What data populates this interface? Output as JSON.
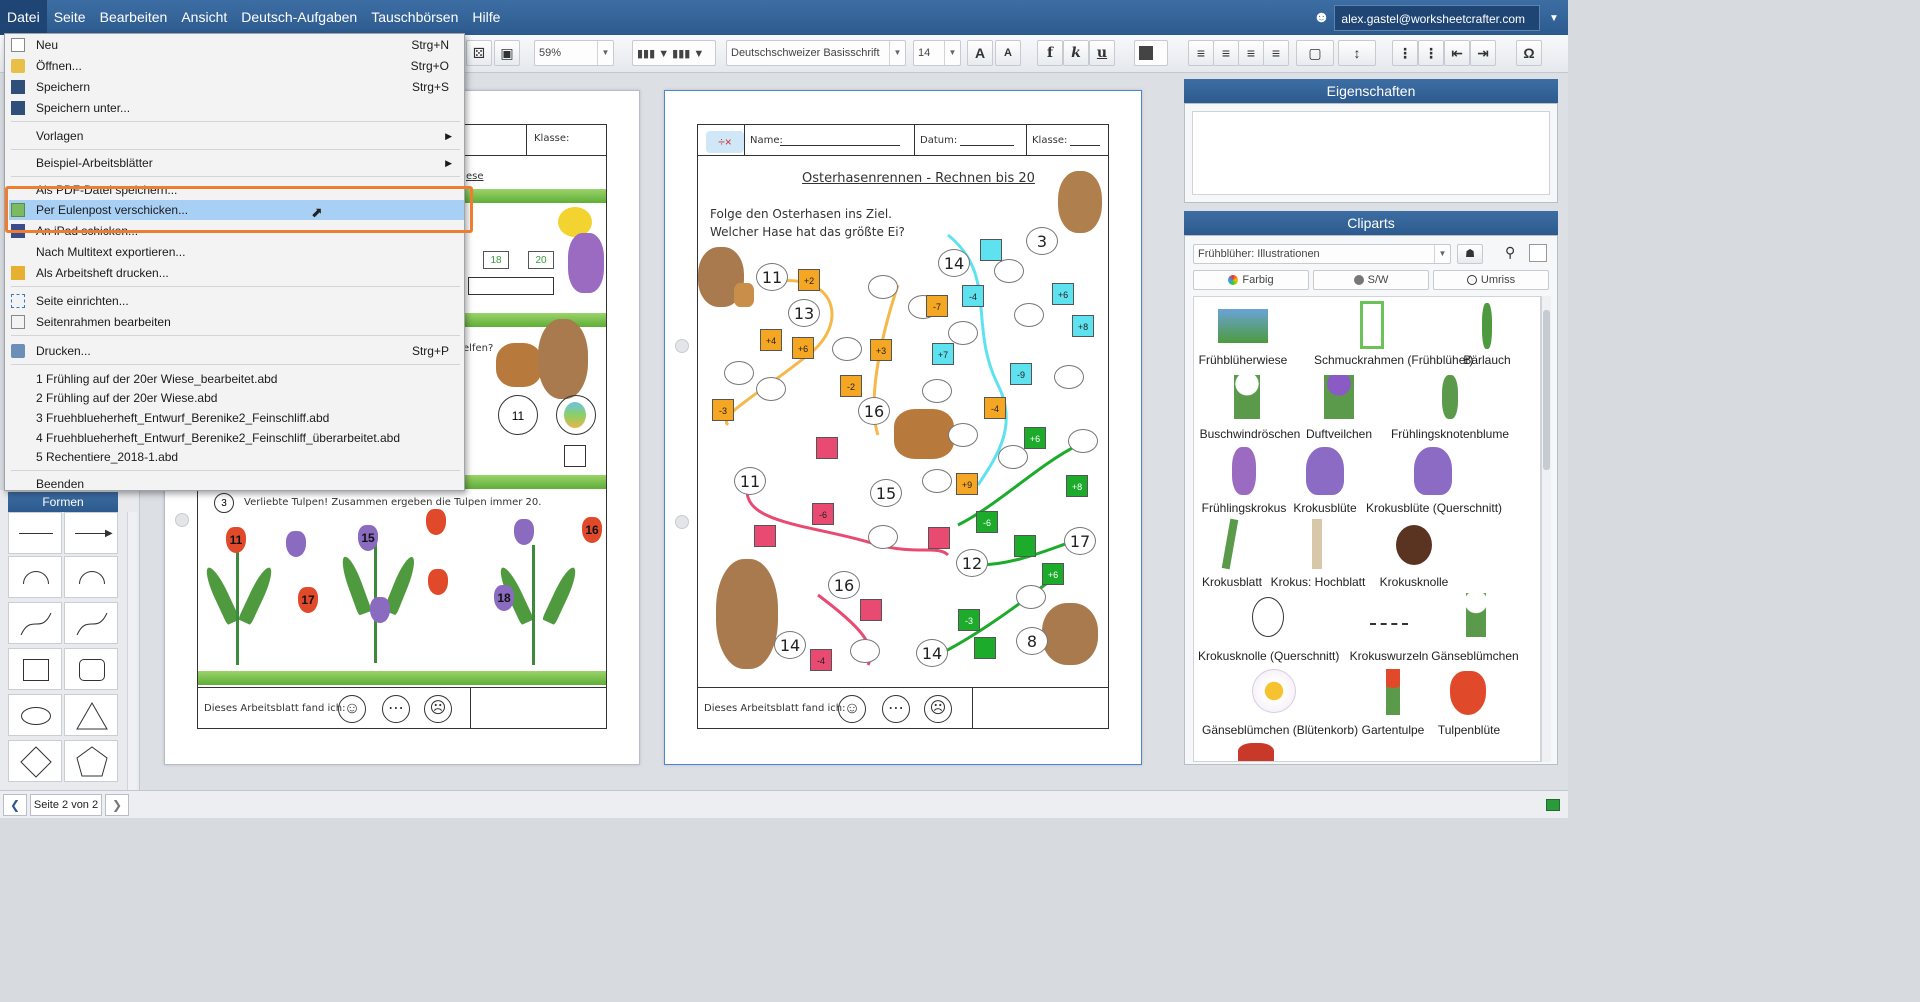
{
  "menubar": {
    "items": [
      "Datei",
      "Seite",
      "Bearbeiten",
      "Ansicht",
      "Deutsch-Aufgaben",
      "Tauschbörsen",
      "Hilfe"
    ],
    "user_email": "alex.gastel@worksheetcrafter.com"
  },
  "toolbar": {
    "zoom": "59%",
    "font": "Deutschschweizer Basisschrift",
    "font_size": "14",
    "bold": "f",
    "italic": "k",
    "underline": "u"
  },
  "file_menu": {
    "items": [
      {
        "label": "Neu",
        "shortcut": "Strg+N"
      },
      {
        "label": "Öffnen...",
        "shortcut": "Strg+O"
      },
      {
        "label": "Speichern",
        "shortcut": "Strg+S"
      },
      {
        "label": "Speichern unter...",
        "shortcut": ""
      },
      {
        "label": "Vorlagen",
        "shortcut": ""
      },
      {
        "label": "Beispiel-Arbeitsblätter",
        "shortcut": ""
      },
      {
        "label": "Als PDF-Datei speichern...",
        "shortcut": ""
      },
      {
        "label": "Per Eulenpost verschicken...",
        "shortcut": ""
      },
      {
        "label": "An iPad schicken...",
        "shortcut": ""
      },
      {
        "label": "Nach Multitext exportieren...",
        "shortcut": ""
      },
      {
        "label": "Als Arbeitsheft drucken...",
        "shortcut": ""
      },
      {
        "label": "Seite einrichten...",
        "shortcut": ""
      },
      {
        "label": "Seitenrahmen bearbeiten",
        "shortcut": ""
      },
      {
        "label": "Drucken...",
        "shortcut": "Strg+P"
      },
      {
        "label": "1 Frühling auf der 20er Wiese_bearbeitet.abd",
        "shortcut": ""
      },
      {
        "label": "2 Frühling auf der 20er Wiese.abd",
        "shortcut": ""
      },
      {
        "label": "3 Fruehblueherheft_Entwurf_Berenike2_Feinschliff.abd",
        "shortcut": ""
      },
      {
        "label": "4 Fruehblueherheft_Entwurf_Berenike2_Feinschliff_überarbeitet.abd",
        "shortcut": ""
      },
      {
        "label": "5 Rechentiere_2018-1.abd",
        "shortcut": ""
      },
      {
        "label": "Beenden",
        "shortcut": ""
      }
    ]
  },
  "worksheet_left": {
    "header_klasse": "Klasse:",
    "snippet_ese": "ese",
    "snippet_elfen": "elfen?",
    "number_line": [
      "18",
      "20"
    ],
    "circle_11": "11",
    "task3": "Verliebte Tulpen! Zusammen ergeben die Tulpen immer 20.",
    "tulip_numbers": [
      "11",
      "15",
      "16",
      "17",
      "18"
    ],
    "footer": "Dieses Arbeitsblatt fand ich:"
  },
  "worksheet_right": {
    "header": {
      "name": "Name:",
      "datum": "Datum:",
      "klasse": "Klasse:"
    },
    "title": "Osterhasenrennen - Rechnen bis 20",
    "instruction_1": "Folge den Osterhasen ins Ziel.",
    "instruction_2": "Welcher Hase hat das größte Ei?",
    "start_numbers": [
      "11",
      "3",
      "14",
      "13",
      "16",
      "11",
      "15",
      "12",
      "17",
      "16",
      "14",
      "14",
      "8"
    ],
    "ops": [
      "+2",
      "+4",
      "+6",
      "+3",
      "-2",
      "-7",
      "-4",
      "+6",
      "+8",
      "+7",
      "-9",
      "-4",
      "-3",
      "-6",
      "+9",
      "+6",
      "+8",
      "-6",
      "+6",
      "-3",
      "-4"
    ],
    "footer": "Dieses Arbeitsblatt fand ich:"
  },
  "shapes_panel": {
    "title": "Formen"
  },
  "properties_panel": {
    "title": "Eigenschaften"
  },
  "cliparts_panel": {
    "title": "Cliparts",
    "category": "Frühblüher: Illustrationen",
    "modes": [
      "Farbig",
      "S/W",
      "Umriss"
    ],
    "items": [
      "Frühblüherwiese",
      "Schmuckrahmen (Frühblüher)",
      "Bärlauch",
      "Buschwindröschen",
      "Duftveilchen",
      "Frühlingsknotenblume",
      "Frühlingskrokus",
      "Krokusblüte",
      "Krokusblüte (Querschnitt)",
      "Krokusblatt",
      "Krokus: Hochblatt",
      "Krokusknolle",
      "Krokusknolle (Querschnitt)",
      "Krokuswurzeln",
      "Gänseblümchen",
      "Gänseblümchen (Blütenkorb)",
      "Gartentulpe",
      "Tulpenblüte"
    ]
  },
  "status": {
    "page_label": "Seite 2 von 2"
  }
}
